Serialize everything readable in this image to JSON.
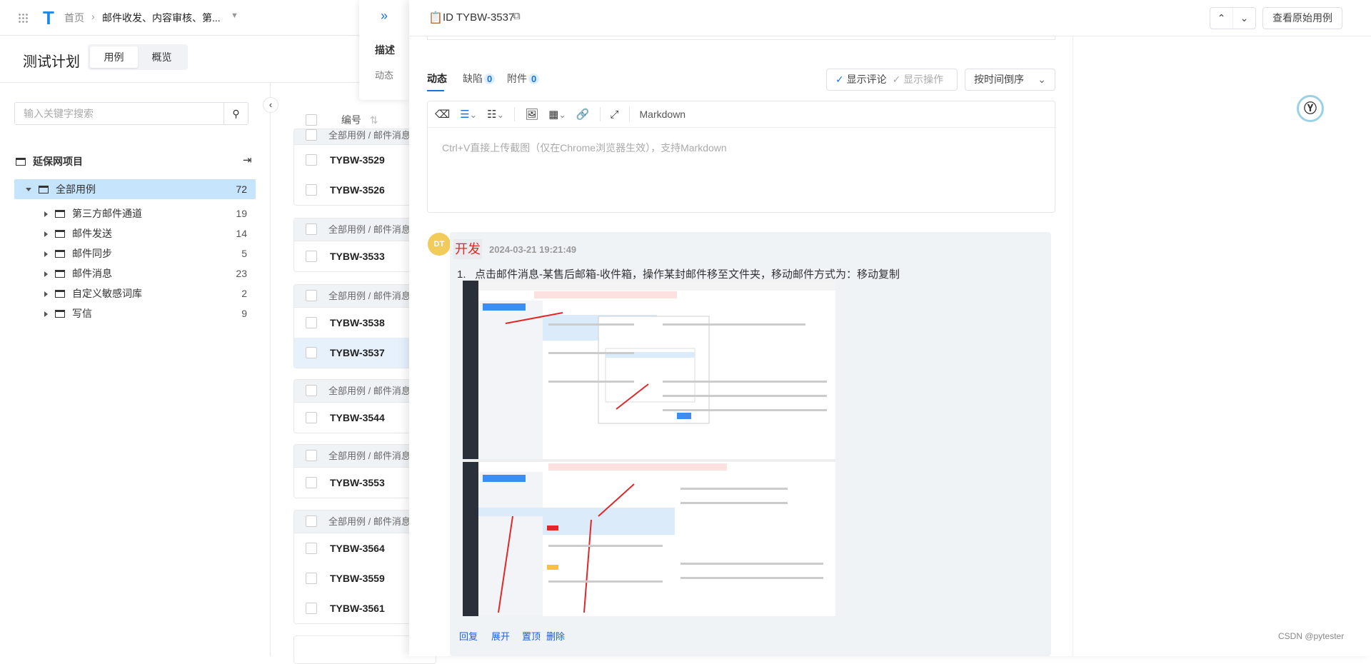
{
  "topbar": {
    "home": "首页",
    "plan_name": "邮件收发、内容审核、第..."
  },
  "plan": {
    "title": "测试计划",
    "tabs": [
      "用例",
      "概览"
    ]
  },
  "sidebar": {
    "search_placeholder": "输入关键字搜索",
    "project": "延保网项目",
    "root": {
      "label": "全部用例",
      "count": "72"
    },
    "items": [
      {
        "label": "第三方邮件通道",
        "count": "19"
      },
      {
        "label": "邮件发送",
        "count": "14"
      },
      {
        "label": "邮件同步",
        "count": "5"
      },
      {
        "label": "邮件消息",
        "count": "23"
      },
      {
        "label": "自定义敏感词库",
        "count": "2"
      },
      {
        "label": "写信",
        "count": "9"
      }
    ]
  },
  "list": {
    "column_id": "编号",
    "group_path": "全部用例  /  邮件消息",
    "groups": [
      {
        "rows": [
          "TYBW-3529",
          "TYBW-3526"
        ]
      },
      {
        "rows": [
          "TYBW-3533"
        ]
      },
      {
        "rows": [
          "TYBW-3538",
          "TYBW-3537"
        ]
      },
      {
        "rows": [
          "TYBW-3544"
        ]
      },
      {
        "rows": [
          "TYBW-3553"
        ]
      },
      {
        "rows": [
          "TYBW-3564",
          "TYBW-3559",
          "TYBW-3561"
        ]
      }
    ],
    "selected": "TYBW-3537"
  },
  "nav": {
    "items": [
      "描述",
      "动态"
    ]
  },
  "detail": {
    "id": "ID TYBW-3537",
    "view_original": "查看原始用例",
    "tabs": [
      {
        "label": "动态"
      },
      {
        "label": "缺陷",
        "count": "0"
      },
      {
        "label": "附件",
        "count": "0"
      }
    ],
    "show_comments": "显示评论",
    "show_actions": "显示操作",
    "sort": "按时间倒序",
    "editor_mode": "Markdown",
    "editor_placeholder": "Ctrl+V直接上传截图（仅在Chrome浏览器生效），支持Markdown",
    "comment": {
      "avatar": "DT",
      "author": "开发",
      "time": "2024-03-21 19:21:49",
      "text": "点击邮件消息-某售后邮箱-收件箱，操作某封邮件移至文件夹，移动邮件方式为：移动复制",
      "actions": [
        "回复",
        "展开",
        "置顶",
        "删除"
      ]
    }
  },
  "watermark": "CSDN @pytester",
  "colors": {
    "accent": "#1a73d9",
    "selected_bg": "#c6e4fb",
    "author": "#e02828",
    "avatar": "#f2cc5a"
  }
}
